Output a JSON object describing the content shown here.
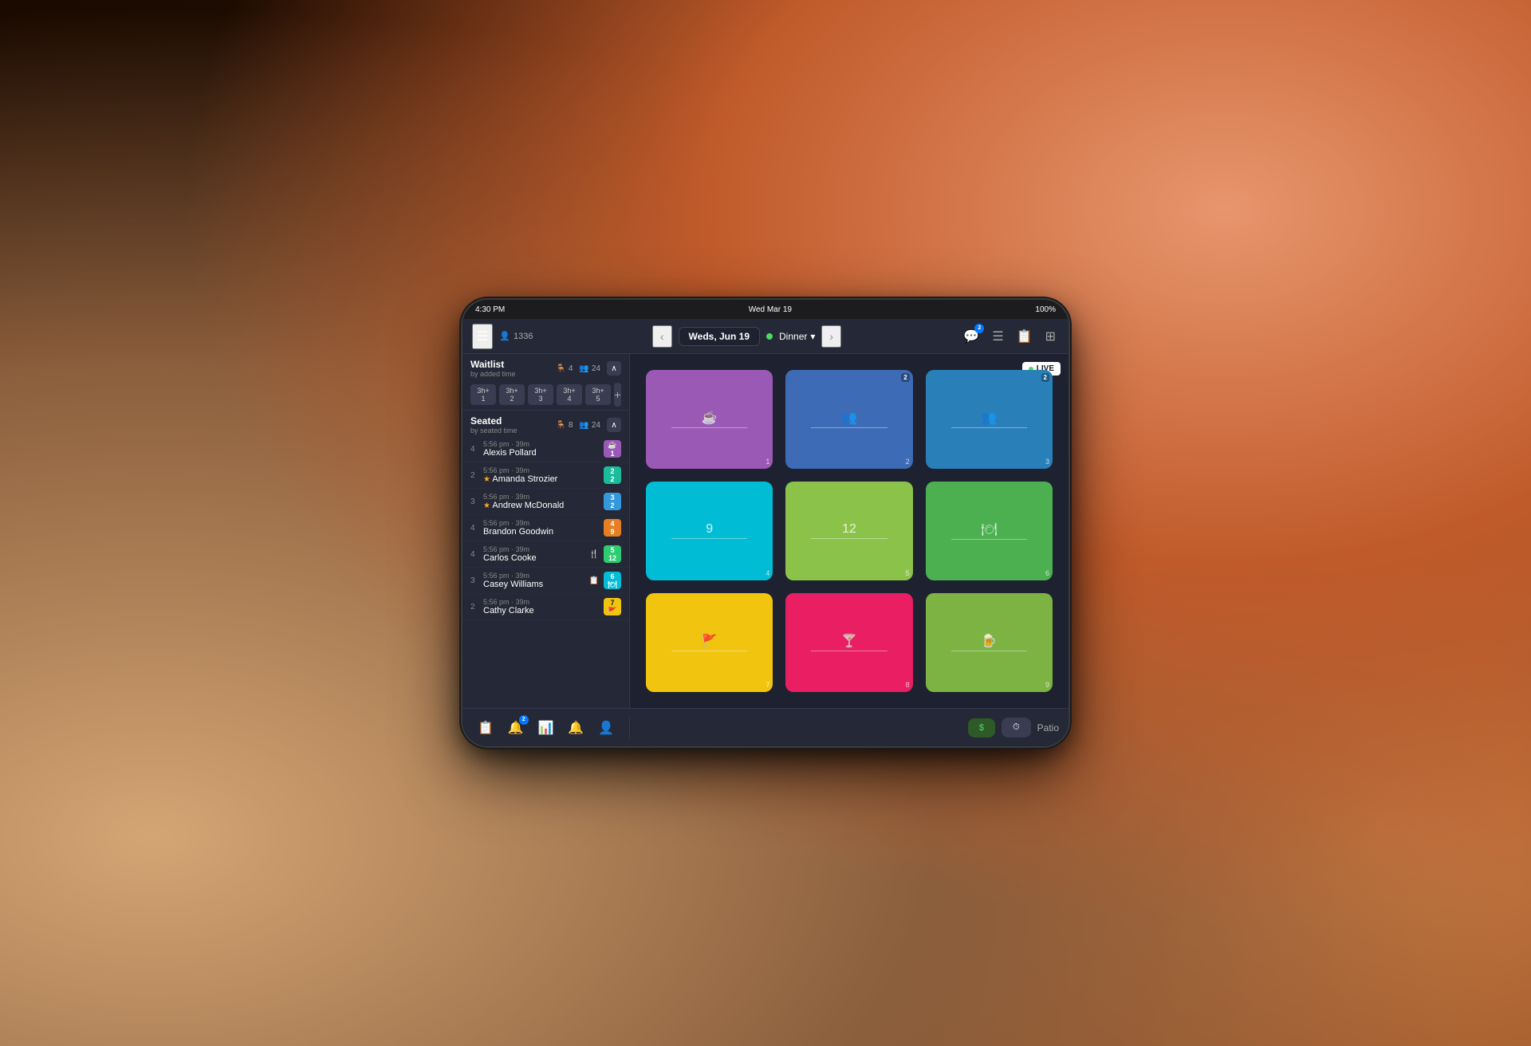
{
  "status_bar": {
    "time": "4:30 PM",
    "date": "Wed Mar 19",
    "battery": "100%"
  },
  "top_nav": {
    "guests_icon": "👤",
    "guests_count": "1336",
    "date": "Weds, Jun 19",
    "service": "Dinner",
    "nav_prev": "‹",
    "nav_next": "›",
    "icon_message": "💬",
    "icon_message_badge": "2",
    "icon_list": "☰",
    "icon_report": "📋",
    "icon_layout": "⊞"
  },
  "waitlist": {
    "title": "Waitlist",
    "subtitle": "by added time",
    "guests_icon": "👥",
    "tables_count": "4",
    "guests_count": "24",
    "slots": [
      "3h+\n1",
      "3h+\n2",
      "3h+\n3",
      "3h+\n4",
      "3h+\n5"
    ]
  },
  "seated": {
    "title": "Seated",
    "subtitle": "by seated time",
    "tables_count": "8",
    "guests_count": "24",
    "guests": [
      {
        "num": "4",
        "time": "5:56 pm",
        "wait": "39m",
        "name": "Alexis Pollard",
        "badge_num": "1",
        "badge_color": "purple",
        "star": false,
        "icons": [
          "☕"
        ]
      },
      {
        "num": "2",
        "time": "5:56 pm",
        "wait": "39m",
        "name": "Amanda Strozier",
        "badge_num": "2",
        "badge_color": "teal",
        "star": true,
        "icons": [
          "2"
        ]
      },
      {
        "num": "3",
        "time": "5:56 pm",
        "wait": "39m",
        "name": "Andrew McDonald",
        "badge_num": "3",
        "badge_color": "blue",
        "star": true,
        "icons": [
          "2"
        ]
      },
      {
        "num": "4",
        "time": "5:56 pm",
        "wait": "39m",
        "name": "Brandon Goodwin",
        "badge_num": "4",
        "badge_color": "orange",
        "star": false,
        "icons": [
          "9"
        ]
      },
      {
        "num": "4",
        "time": "5:56 pm",
        "wait": "39m",
        "name": "Carlos Cooke",
        "badge_num": "5",
        "badge_color": "green",
        "star": false,
        "icons": [
          "🍴",
          "12"
        ]
      },
      {
        "num": "3",
        "time": "5:56 pm",
        "wait": "39m",
        "name": "Casey Williams",
        "badge_num": "6",
        "badge_color": "cyan",
        "star": false,
        "icons": [
          "📋",
          "🍽"
        ]
      },
      {
        "num": "2",
        "time": "5:56 pm",
        "wait": "39m",
        "name": "Cathy Clarke",
        "badge_num": "7",
        "badge_color": "yellow",
        "star": false,
        "icons": [
          "🚩"
        ]
      }
    ]
  },
  "floor_plan": {
    "live_label": "LIVE",
    "tables": [
      {
        "id": 1,
        "num": "1",
        "color": "purple",
        "icon": "☕",
        "guests": null
      },
      {
        "id": 2,
        "num": "2",
        "color": "blue-dark",
        "icon": "2",
        "guests": "2"
      },
      {
        "id": 3,
        "num": "3",
        "color": "blue",
        "icon": "2",
        "guests": "2"
      },
      {
        "id": 4,
        "num": "4",
        "color": "cyan",
        "icon": "9",
        "guests": null
      },
      {
        "id": 5,
        "num": "5",
        "color": "yellow-green",
        "icon": "12",
        "guests": null
      },
      {
        "id": 6,
        "num": "6",
        "color": "green",
        "icon": "🍽",
        "guests": null
      },
      {
        "id": 7,
        "num": "7",
        "color": "yellow",
        "icon": "🚩",
        "guests": null
      },
      {
        "id": 8,
        "num": "8",
        "color": "pink",
        "icon": "🍸",
        "guests": null
      },
      {
        "id": 9,
        "num": "9",
        "color": "olive",
        "icon": "🍺",
        "guests": null
      }
    ]
  },
  "bottom_bar": {
    "icons": [
      "📋",
      "🔔",
      "📊",
      "🔔",
      "👤"
    ],
    "notification_badge": "2",
    "btn_dollar_label": "$",
    "btn_clock_label": "⏱",
    "patio_label": "Patio"
  }
}
